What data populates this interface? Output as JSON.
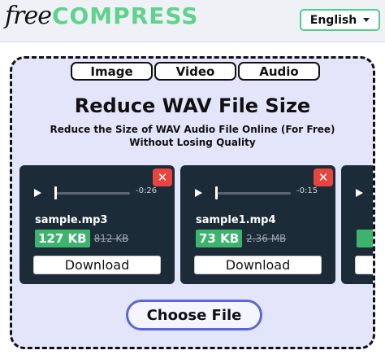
{
  "header": {
    "logo_free": "free",
    "logo_compress": "COMPRESS",
    "language": "English"
  },
  "tabs": [
    {
      "label": "Image"
    },
    {
      "label": "Video"
    },
    {
      "label": "Audio"
    }
  ],
  "main": {
    "title": "Reduce WAV File Size",
    "subtitle_line1": "Reduce the Size of WAV Audio File Online (For Free)",
    "subtitle_line2": "Without Losing Quality",
    "choose_label": "Choose File"
  },
  "files": [
    {
      "name": "sample.mp3",
      "new_size": "127 KB",
      "old_size": "812 KB",
      "time": "-0:26",
      "download": "Download"
    },
    {
      "name": "sample1.mp4",
      "new_size": "73 KB",
      "old_size": "2.36 MB",
      "time": "-0:15",
      "download": "Download"
    }
  ],
  "colors": {
    "accent_green": "#5fd38c",
    "size_badge": "#3db46d",
    "card_bg": "#1c2b38",
    "close_red": "#e8453f",
    "panel_bg": "#e3e6fb",
    "choose_border": "#5a68d6"
  },
  "icons": {
    "close": "close-icon",
    "play": "play-icon",
    "caret": "chevron-down-icon"
  }
}
